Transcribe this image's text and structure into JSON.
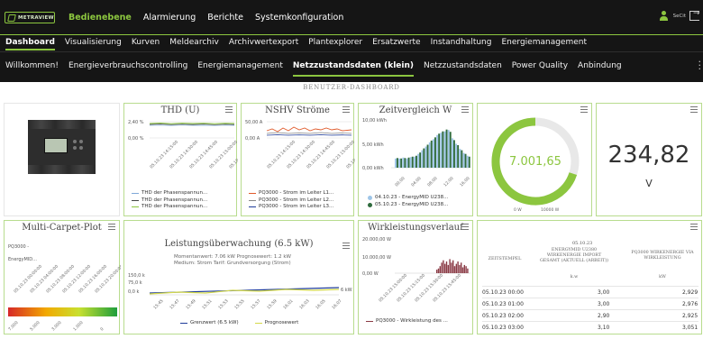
{
  "app": {
    "logo_text": "METRAVIEW",
    "menu1": [
      "Bedienebene",
      "Alarmierung",
      "Berichte",
      "Systemkonfiguration"
    ],
    "menu1_active": 0,
    "user_name": "SeCit"
  },
  "menu2": {
    "items": [
      "Dashboard",
      "Visualisierung",
      "Kurven",
      "Meldearchiv",
      "Archivwertexport",
      "Plantexplorer",
      "Ersatzwerte",
      "Instandhaltung",
      "Energiemanagement"
    ],
    "active": 0
  },
  "menu3": {
    "items": [
      "Willkommen!",
      "Energieverbrauchscontrolling",
      "Energiemanagement",
      "Netzzustandsdaten (klein)",
      "Netzzustandsdaten",
      "Power Quality",
      "Anbindung"
    ],
    "active": 3
  },
  "dashboard": {
    "title": "BENUTZER-DASHBOARD"
  },
  "colors": {
    "accent": "#8cc63f",
    "topbar": "#151515",
    "card_border": "#b8dc8e"
  },
  "widgets": {
    "thd": {
      "title": "THD (U)",
      "y_ticks": [
        "2,40 %",
        "0,00 %"
      ],
      "legend": [
        "THD der Phasenspannun...",
        "THD der Phasenspannun...",
        "THD der Phasenspannun..."
      ]
    },
    "nshv": {
      "title": "NSHV Ströme",
      "y_ticks": [
        "50,00 A",
        "0,00 A"
      ],
      "legend": [
        "PQ3000 - Strom im Leiter L1...",
        "PQ3000 - Strom im Leiter L2...",
        "PQ3000 - Strom im Leiter L3..."
      ]
    },
    "zeitvergleich": {
      "title": "Zeitvergleich W",
      "y_ticks": [
        "10,00 kWh",
        "5,00 kWh",
        "0,00 kWh"
      ],
      "legend": [
        "04.10.23 - EnergyMID U238...",
        "05.10.23 - EnergyMID U238..."
      ]
    },
    "gauge": {
      "value": "7.001,65",
      "min": "0 W",
      "max": "10000 W",
      "fraction": 0.7
    },
    "bigvalue": {
      "value": "234,82",
      "unit": "V"
    },
    "carpet": {
      "title": "Multi-Carpet-Plot",
      "rows": [
        "PQ3000 -",
        "EnergyMID..."
      ]
    },
    "leistung": {
      "title": "Leistungsüberwachung (6.5 kW)",
      "info1": "Momentanwert: 7.06 kW Prognosewert: 1.2 kW",
      "info2": "Medium: Strom Tarif: Grundversorgung (Strom)",
      "y_ticks": [
        "150,0 k",
        "75,0 k",
        "0,0 k"
      ],
      "right_label": "6 kW",
      "legend": [
        "Grenzwert (6.5 kW)",
        "Prognosewert"
      ]
    },
    "wirk": {
      "title": "Wirkleistungsverlauf",
      "y_ticks": [
        "20.000,00 W",
        "10.000,00 W",
        "0,00 W"
      ],
      "legend": [
        "PQ3000 - Wirkleistung des ..."
      ]
    },
    "table": {
      "date": "05.10.23",
      "headers": [
        "ZEITSTEMPEL",
        "ENERGYMID U2380 WIRKENERGIE IMPORT GESAMT (AKTUELL (ARBEIT))",
        "PQ3000 WIRKENERGIE VIA WIRKLEISTUNG"
      ],
      "sub": [
        "",
        "k.w",
        "kW"
      ],
      "rows": [
        [
          "05.10.23 00:00",
          "3,00",
          "2,929"
        ],
        [
          "05.10.23 01:00",
          "3,00",
          "2,976"
        ],
        [
          "05.10.23 02:00",
          "2,90",
          "2,925"
        ],
        [
          "05.10.23 03:00",
          "3,10",
          "3,051"
        ]
      ]
    }
  }
}
